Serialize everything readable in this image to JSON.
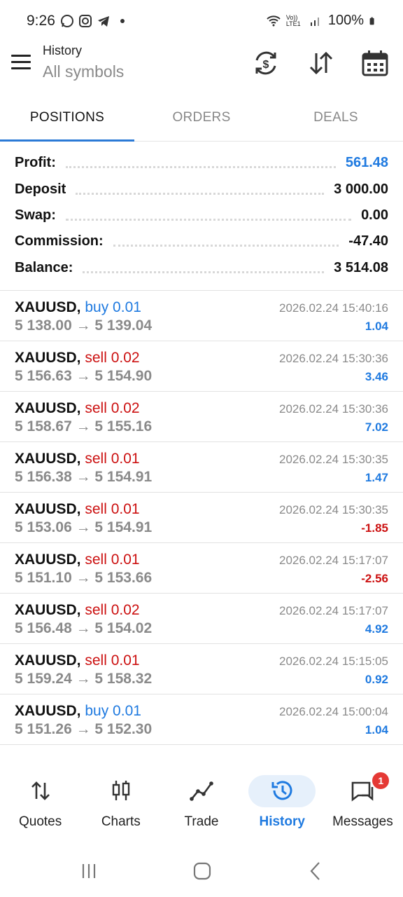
{
  "status": {
    "time": "9:26",
    "network": "Vo)) LTE1",
    "battery": "100%"
  },
  "header": {
    "title": "History",
    "subtitle": "All symbols"
  },
  "tabs": [
    {
      "label": "POSITIONS",
      "active": true
    },
    {
      "label": "ORDERS",
      "active": false
    },
    {
      "label": "DEALS",
      "active": false
    }
  ],
  "summary": [
    {
      "label": "Profit:",
      "value": "561.48",
      "accent": true
    },
    {
      "label": "Deposit",
      "value": "3 000.00",
      "accent": false
    },
    {
      "label": "Swap:",
      "value": "0.00",
      "accent": false
    },
    {
      "label": "Commission:",
      "value": "-47.40",
      "accent": false
    },
    {
      "label": "Balance:",
      "value": "3 514.08",
      "accent": false
    }
  ],
  "positions": [
    {
      "symbol": "XAUUSD,",
      "direction": "buy 0.01",
      "side": "buy",
      "prices": "5 138.00 → 5 139.04",
      "time": "2026.02.24 15:40:16",
      "profit": "1.04"
    },
    {
      "symbol": "XAUUSD,",
      "direction": "sell 0.02",
      "side": "sell",
      "prices": "5 156.63 → 5 154.90",
      "time": "2026.02.24 15:30:36",
      "profit": "3.46"
    },
    {
      "symbol": "XAUUSD,",
      "direction": "sell 0.02",
      "side": "sell",
      "prices": "5 158.67 → 5 155.16",
      "time": "2026.02.24 15:30:36",
      "profit": "7.02"
    },
    {
      "symbol": "XAUUSD,",
      "direction": "sell 0.01",
      "side": "sell",
      "prices": "5 156.38 → 5 154.91",
      "time": "2026.02.24 15:30:35",
      "profit": "1.47"
    },
    {
      "symbol": "XAUUSD,",
      "direction": "sell 0.01",
      "side": "sell",
      "prices": "5 153.06 → 5 154.91",
      "time": "2026.02.24 15:30:35",
      "profit": "-1.85"
    },
    {
      "symbol": "XAUUSD,",
      "direction": "sell 0.01",
      "side": "sell",
      "prices": "5 151.10 → 5 153.66",
      "time": "2026.02.24 15:17:07",
      "profit": "-2.56"
    },
    {
      "symbol": "XAUUSD,",
      "direction": "sell 0.02",
      "side": "sell",
      "prices": "5 156.48 → 5 154.02",
      "time": "2026.02.24 15:17:07",
      "profit": "4.92"
    },
    {
      "symbol": "XAUUSD,",
      "direction": "sell 0.01",
      "side": "sell",
      "prices": "5 159.24 → 5 158.32",
      "time": "2026.02.24 15:15:05",
      "profit": "0.92"
    },
    {
      "symbol": "XAUUSD,",
      "direction": "buy 0.01",
      "side": "buy",
      "prices": "5 151.26 → 5 152.30",
      "time": "2026.02.24 15:00:04",
      "profit": "1.04"
    }
  ],
  "bottom_nav": [
    {
      "label": "Quotes",
      "icon": "quotes-icon",
      "active": false
    },
    {
      "label": "Charts",
      "icon": "charts-icon",
      "active": false
    },
    {
      "label": "Trade",
      "icon": "trade-icon",
      "active": false
    },
    {
      "label": "History",
      "icon": "history-icon",
      "active": true
    },
    {
      "label": "Messages",
      "icon": "messages-icon",
      "active": false,
      "badge": "1"
    }
  ],
  "colors": {
    "accent": "#1f7ae0",
    "negative": "#cc1111"
  }
}
